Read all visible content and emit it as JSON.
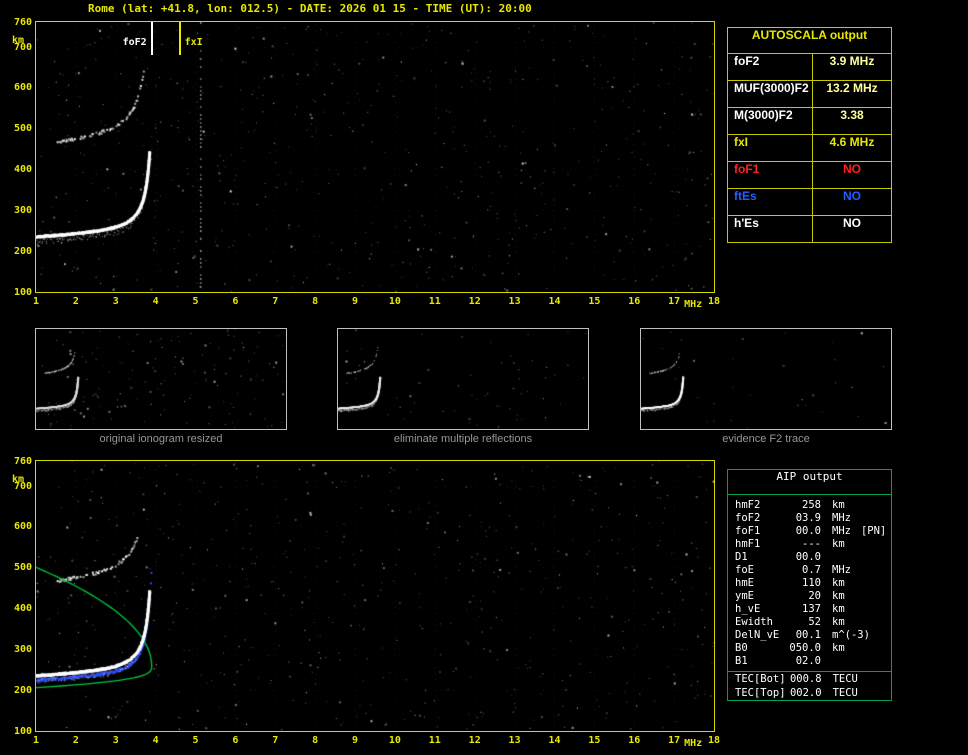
{
  "title": "Rome (lat: +41.8, lon: 012.5) - DATE: 2026 01 15 - TIME (UT): 20:00",
  "colors": {
    "accent_yellow": "#e8e800",
    "table_border_yellow": "#c8c800",
    "aip_border_green": "#00a050",
    "profile_green": "#00c840",
    "trace_blue": "#2b4bff",
    "no_red": "#ff2020",
    "no_blue": "#2060ff"
  },
  "ionogram_axes": {
    "x_unit": "MHz",
    "y_unit": "km",
    "x_range": [
      1,
      18
    ],
    "y_range": [
      100,
      760
    ],
    "x_ticks": [
      1,
      2,
      3,
      4,
      5,
      6,
      7,
      8,
      9,
      10,
      11,
      12,
      13,
      14,
      15,
      16,
      17,
      18
    ],
    "y_ticks": [
      760,
      700,
      600,
      500,
      400,
      300,
      200,
      100
    ]
  },
  "markers": [
    {
      "id": "foF2",
      "label": "foF2",
      "freq_mhz": 3.9,
      "color": "#ffffff"
    },
    {
      "id": "fxI",
      "label": "fxI",
      "freq_mhz": 4.6,
      "color": "#e8e800"
    }
  ],
  "trace": {
    "foF2_mhz": 3.9,
    "hmF2_km": 258,
    "base_km": 231,
    "topside_top_km": 500,
    "bottom_km": 206
  },
  "autoscala_table": {
    "title": "AUTOSCALA output",
    "rows": [
      {
        "label": "foF2",
        "value": "3.9 MHz",
        "label_color": "#ffffff",
        "value_color": "#ffffa0"
      },
      {
        "label": "MUF(3000)F2",
        "value": "13.2 MHz",
        "label_color": "#ffffff",
        "value_color": "#ffffa0"
      },
      {
        "label": "M(3000)F2",
        "value": "3.38",
        "label_color": "#ffffff",
        "value_color": "#ffffa0"
      },
      {
        "label": "fxI",
        "value": "4.6 MHz",
        "label_color": "#e8e800",
        "value_color": "#e8e800"
      },
      {
        "label": "foF1",
        "value": "NO",
        "label_color": "#ff2020",
        "value_color": "#ff2020"
      },
      {
        "label": "ftEs",
        "value": "NO",
        "label_color": "#2060ff",
        "value_color": "#2060ff"
      },
      {
        "label": "h'Es",
        "value": "NO",
        "label_color": "#ffffff",
        "value_color": "#ffffff"
      }
    ]
  },
  "panels": [
    {
      "caption": "original ionogram resized"
    },
    {
      "caption": "eliminate multiple reflections"
    },
    {
      "caption": "evidence F2 trace"
    }
  ],
  "aip_table": {
    "title": "AIP output",
    "rows": [
      {
        "name": "hmF2",
        "value": "258",
        "unit": "km"
      },
      {
        "name": "foF2",
        "value": "03.9",
        "unit": "MHz"
      },
      {
        "name": "foF1",
        "value": "00.0",
        "unit": "MHz",
        "note": "[PN]"
      },
      {
        "name": "hmF1",
        "value": "---",
        "unit": "km"
      },
      {
        "name": "D1",
        "value": "00.0",
        "unit": ""
      },
      {
        "name": "foE",
        "value": "0.7",
        "unit": "MHz"
      },
      {
        "name": "hmE",
        "value": "110",
        "unit": "km"
      },
      {
        "name": "ymE",
        "value": "20",
        "unit": "km"
      },
      {
        "name": "h_vE",
        "value": "137",
        "unit": "km"
      },
      {
        "name": "Ewidth",
        "value": "52",
        "unit": "km"
      },
      {
        "name": "DelN_vE",
        "value": "00.1",
        "unit": "m^(-3)"
      },
      {
        "name": "B0",
        "value": "050.0",
        "unit": "km"
      },
      {
        "name": "B1",
        "value": "02.0",
        "unit": ""
      },
      {
        "name": "TEC[Bot]",
        "value": "000.8",
        "unit": "TECU",
        "sep": true
      },
      {
        "name": "TEC[Top]",
        "value": "002.0",
        "unit": "TECU"
      }
    ]
  }
}
